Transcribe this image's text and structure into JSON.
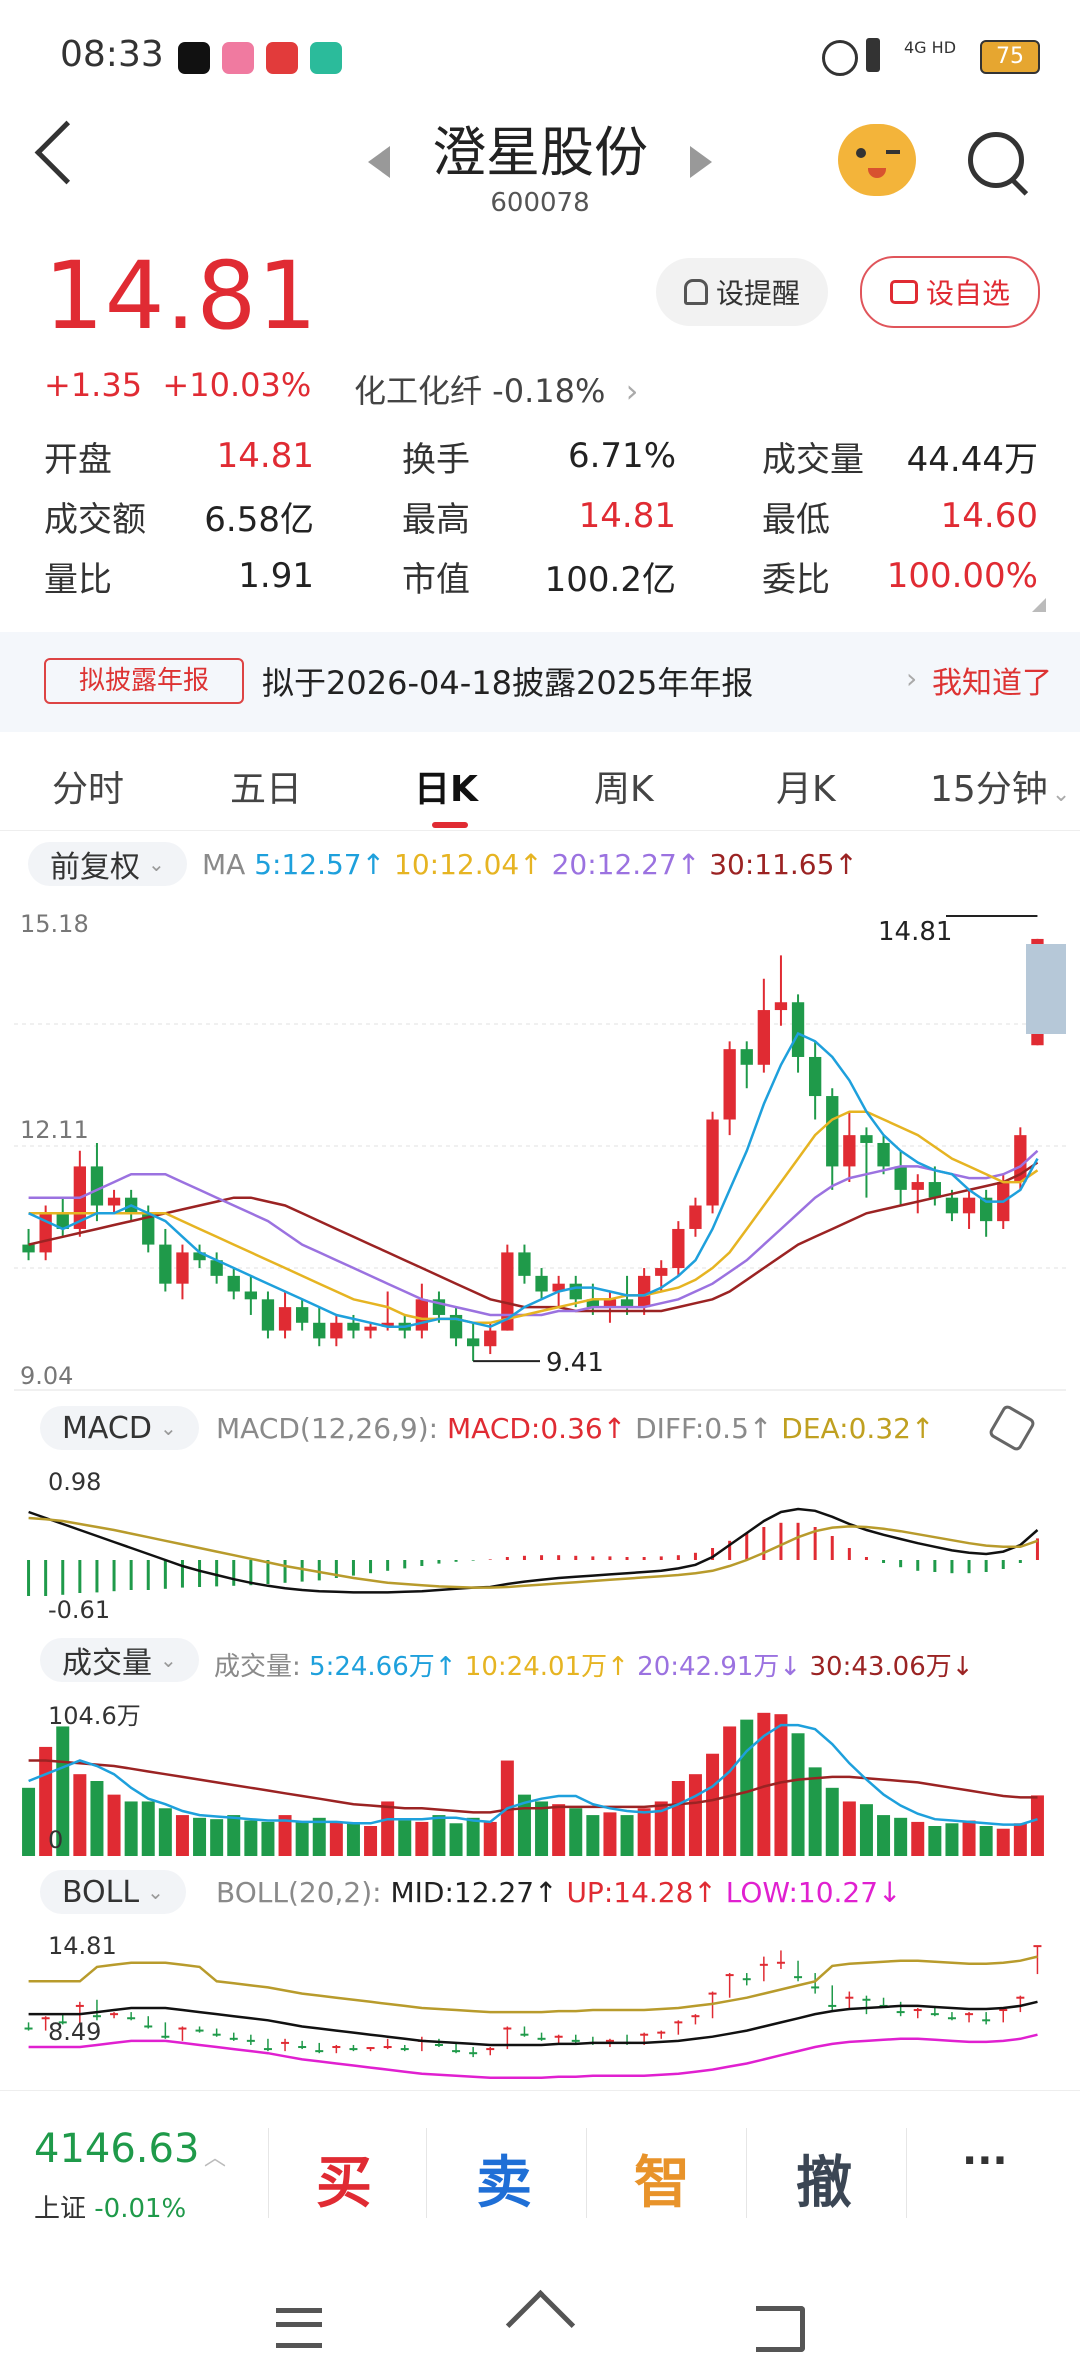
{
  "status": {
    "time": "08:33",
    "network": "4G HD",
    "battery": "75"
  },
  "header": {
    "title": "澄星股份",
    "code": "600078"
  },
  "price": {
    "last": "14.81",
    "change": "+1.35",
    "pct": "+10.03%",
    "sector": "化工化纤 -0.18%"
  },
  "buttons": {
    "alert": "设提醒",
    "favorite": "设自选"
  },
  "quote": {
    "c1": [
      {
        "label": "开盘",
        "value": "14.81"
      },
      {
        "label": "成交额",
        "value": "6.58亿"
      },
      {
        "label": "量比",
        "value": "1.91"
      }
    ],
    "c2": [
      {
        "label": "换手",
        "value": "6.71%"
      },
      {
        "label": "最高",
        "value": "14.81"
      },
      {
        "label": "市值",
        "value": "100.2亿"
      }
    ],
    "c3": [
      {
        "label": "成交量",
        "value": "44.44万"
      },
      {
        "label": "最低",
        "value": "14.60"
      },
      {
        "label": "委比",
        "value": "100.00%"
      }
    ]
  },
  "notice": {
    "tag": "拟披露年报",
    "text": "拟于2026-04-18披露2025年年报",
    "action": "我知道了"
  },
  "tabs": [
    "分时",
    "五日",
    "日K",
    "周K",
    "月K",
    "15分钟"
  ],
  "adjust": "前复权",
  "ma": {
    "label": "MA",
    "ma5": "5:12.57↑",
    "ma10": "10:12.04↑",
    "ma20": "20:12.27↑",
    "ma30": "30:11.65↑"
  },
  "kline": {
    "ymax": "15.18",
    "ymid": "12.11",
    "ymin": "9.04",
    "high_mark": "14.81",
    "low_mark": "9.41"
  },
  "macd": {
    "chip": "MACD",
    "params": "MACD(12,26,9):",
    "macd": "MACD:0.36↑",
    "diff": "DIFF:0.5↑",
    "dea": "DEA:0.32↑",
    "top": "0.98",
    "bottom": "-0.61"
  },
  "volume": {
    "chip": "成交量",
    "label": "成交量:",
    "v5": "5:24.66万↑",
    "v10": "10:24.01万↑",
    "v20": "20:42.91万↓",
    "v30": "30:43.06万↓",
    "top": "104.6万",
    "zero": "0"
  },
  "boll": {
    "chip": "BOLL",
    "params": "BOLL(20,2):",
    "mid": "MID:12.27↑",
    "up": "UP:14.28↑",
    "low": "LOW:10.27↓",
    "top": "14.81",
    "bottom": "8.49"
  },
  "index": {
    "value": "4146.63",
    "name": "上证",
    "pct": "-0.01%"
  },
  "actions": {
    "buy": "买",
    "sell": "卖",
    "smart": "智",
    "cancel": "撤",
    "more": "···"
  },
  "colors": {
    "up": "#e02b33",
    "down": "#1f9a4a",
    "ma5": "#1ea0dc",
    "ma10": "#e6b422",
    "ma20": "#9b72e0",
    "ma30": "#9b2323"
  },
  "chart_data": {
    "type": "candlestick",
    "ylim": [
      9.04,
      15.18
    ],
    "candles": [
      [
        10.9,
        11.1,
        10.7,
        10.8
      ],
      [
        10.8,
        11.4,
        10.7,
        11.3
      ],
      [
        11.3,
        11.5,
        11.0,
        11.1
      ],
      [
        11.1,
        12.1,
        11.0,
        11.9
      ],
      [
        11.9,
        12.2,
        11.2,
        11.4
      ],
      [
        11.4,
        11.6,
        11.3,
        11.5
      ],
      [
        11.5,
        11.6,
        11.2,
        11.3
      ],
      [
        11.3,
        11.4,
        10.8,
        10.9
      ],
      [
        10.9,
        11.1,
        10.3,
        10.4
      ],
      [
        10.4,
        10.9,
        10.2,
        10.8
      ],
      [
        10.8,
        10.9,
        10.6,
        10.7
      ],
      [
        10.7,
        10.8,
        10.4,
        10.5
      ],
      [
        10.5,
        10.6,
        10.2,
        10.3
      ],
      [
        10.3,
        10.5,
        10.0,
        10.2
      ],
      [
        10.2,
        10.3,
        9.7,
        9.8
      ],
      [
        9.8,
        10.3,
        9.7,
        10.1
      ],
      [
        10.1,
        10.2,
        9.8,
        9.9
      ],
      [
        9.9,
        10.1,
        9.6,
        9.7
      ],
      [
        9.7,
        10.0,
        9.6,
        9.9
      ],
      [
        9.9,
        10.0,
        9.7,
        9.8
      ],
      [
        9.8,
        9.9,
        9.7,
        9.85
      ],
      [
        9.85,
        10.3,
        9.8,
        9.9
      ],
      [
        9.9,
        10.0,
        9.7,
        9.8
      ],
      [
        9.8,
        10.4,
        9.7,
        10.2
      ],
      [
        10.2,
        10.3,
        9.9,
        10.0
      ],
      [
        10.0,
        10.1,
        9.6,
        9.7
      ],
      [
        9.7,
        9.9,
        9.41,
        9.6
      ],
      [
        9.6,
        9.9,
        9.5,
        9.8
      ],
      [
        9.8,
        10.9,
        9.8,
        10.8
      ],
      [
        10.8,
        10.9,
        10.4,
        10.5
      ],
      [
        10.5,
        10.6,
        10.2,
        10.3
      ],
      [
        10.3,
        10.5,
        10.1,
        10.4
      ],
      [
        10.4,
        10.5,
        10.1,
        10.2
      ],
      [
        10.2,
        10.4,
        10.0,
        10.1
      ],
      [
        10.1,
        10.3,
        9.9,
        10.2
      ],
      [
        10.2,
        10.5,
        10.0,
        10.1
      ],
      [
        10.1,
        10.6,
        10.0,
        10.5
      ],
      [
        10.5,
        10.7,
        10.3,
        10.6
      ],
      [
        10.6,
        11.2,
        10.5,
        11.1
      ],
      [
        11.1,
        11.5,
        11.0,
        11.4
      ],
      [
        11.4,
        12.6,
        11.3,
        12.5
      ],
      [
        12.5,
        13.5,
        12.3,
        13.4
      ],
      [
        13.4,
        13.5,
        12.9,
        13.2
      ],
      [
        13.2,
        14.3,
        13.1,
        13.9
      ],
      [
        13.9,
        14.6,
        13.7,
        14.0
      ],
      [
        14.0,
        14.1,
        13.1,
        13.3
      ],
      [
        13.3,
        13.5,
        12.5,
        12.8
      ],
      [
        12.8,
        12.9,
        11.6,
        11.9
      ],
      [
        11.9,
        12.6,
        11.7,
        12.3
      ],
      [
        12.3,
        12.4,
        11.5,
        12.2
      ],
      [
        12.2,
        12.3,
        11.8,
        11.9
      ],
      [
        11.9,
        12.1,
        11.4,
        11.6
      ],
      [
        11.6,
        11.8,
        11.3,
        11.7
      ],
      [
        11.7,
        11.9,
        11.4,
        11.5
      ],
      [
        11.5,
        11.6,
        11.2,
        11.3
      ],
      [
        11.3,
        11.6,
        11.1,
        11.5
      ],
      [
        11.5,
        11.6,
        11.0,
        11.2
      ],
      [
        11.2,
        11.8,
        11.1,
        11.7
      ],
      [
        11.7,
        12.4,
        11.6,
        12.3
      ],
      [
        13.45,
        14.81,
        13.45,
        14.81
      ]
    ],
    "ma5": [
      11.3,
      11.2,
      11.1,
      11.2,
      11.3,
      11.3,
      11.4,
      11.3,
      11.2,
      11.0,
      10.8,
      10.7,
      10.6,
      10.5,
      10.4,
      10.3,
      10.2,
      10.1,
      10.0,
      9.95,
      9.9,
      9.85,
      9.85,
      9.9,
      9.95,
      9.95,
      9.9,
      9.85,
      9.95,
      10.1,
      10.2,
      10.3,
      10.35,
      10.35,
      10.3,
      10.25,
      10.25,
      10.35,
      10.5,
      10.7,
      11.1,
      11.6,
      12.1,
      12.7,
      13.2,
      13.6,
      13.5,
      13.3,
      13.0,
      12.6,
      12.3,
      12.1,
      11.95,
      11.85,
      11.8,
      11.6,
      11.45,
      11.45,
      11.6,
      12.0
    ],
    "ma10": [
      11.3,
      11.3,
      11.3,
      11.3,
      11.3,
      11.3,
      11.3,
      11.3,
      11.3,
      11.2,
      11.1,
      11.0,
      10.9,
      10.8,
      10.7,
      10.6,
      10.5,
      10.4,
      10.3,
      10.2,
      10.15,
      10.1,
      10.0,
      9.95,
      9.95,
      9.95,
      9.9,
      9.9,
      9.95,
      10.0,
      10.05,
      10.1,
      10.15,
      10.2,
      10.2,
      10.25,
      10.25,
      10.3,
      10.35,
      10.45,
      10.6,
      10.8,
      11.1,
      11.4,
      11.7,
      12.0,
      12.3,
      12.5,
      12.6,
      12.6,
      12.5,
      12.4,
      12.3,
      12.15,
      12.0,
      11.9,
      11.8,
      11.7,
      11.7,
      11.85
    ],
    "ma20": [
      11.5,
      11.5,
      11.5,
      11.5,
      11.6,
      11.7,
      11.8,
      11.8,
      11.8,
      11.7,
      11.6,
      11.5,
      11.4,
      11.3,
      11.2,
      11.05,
      10.9,
      10.8,
      10.7,
      10.6,
      10.5,
      10.4,
      10.3,
      10.2,
      10.15,
      10.1,
      10.05,
      10.0,
      10.0,
      10.0,
      10.0,
      10.05,
      10.05,
      10.1,
      10.1,
      10.1,
      10.1,
      10.15,
      10.2,
      10.3,
      10.4,
      10.55,
      10.7,
      10.9,
      11.1,
      11.3,
      11.5,
      11.65,
      11.75,
      11.8,
      11.85,
      11.9,
      11.9,
      11.85,
      11.8,
      11.75,
      11.75,
      11.8,
      11.9,
      12.1
    ],
    "ma30": [
      10.9,
      10.95,
      11.0,
      11.05,
      11.1,
      11.15,
      11.2,
      11.25,
      11.3,
      11.35,
      11.4,
      11.45,
      11.5,
      11.5,
      11.45,
      11.4,
      11.3,
      11.2,
      11.1,
      11.0,
      10.9,
      10.8,
      10.7,
      10.6,
      10.5,
      10.4,
      10.3,
      10.2,
      10.15,
      10.1,
      10.1,
      10.1,
      10.05,
      10.05,
      10.05,
      10.05,
      10.05,
      10.05,
      10.1,
      10.15,
      10.2,
      10.3,
      10.45,
      10.6,
      10.75,
      10.9,
      11.0,
      11.1,
      11.2,
      11.3,
      11.35,
      11.4,
      11.45,
      11.5,
      11.55,
      11.6,
      11.65,
      11.7,
      11.8,
      11.95
    ],
    "macd_hist": [
      -0.6,
      -0.6,
      -0.58,
      -0.55,
      -0.54,
      -0.52,
      -0.5,
      -0.5,
      -0.48,
      -0.46,
      -0.45,
      -0.44,
      -0.43,
      -0.42,
      -0.4,
      -0.38,
      -0.36,
      -0.34,
      -0.3,
      -0.26,
      -0.22,
      -0.18,
      -0.14,
      -0.1,
      -0.06,
      -0.03,
      -0.01,
      0.01,
      0.05,
      0.07,
      0.08,
      0.08,
      0.07,
      0.06,
      0.06,
      0.05,
      0.05,
      0.06,
      0.08,
      0.12,
      0.2,
      0.32,
      0.45,
      0.55,
      0.62,
      0.62,
      0.55,
      0.4,
      0.2,
      0.05,
      -0.05,
      -0.12,
      -0.18,
      -0.2,
      -0.22,
      -0.22,
      -0.2,
      -0.15,
      -0.05,
      0.36
    ],
    "diff": [
      0.8,
      0.7,
      0.6,
      0.5,
      0.4,
      0.3,
      0.2,
      0.1,
      0.0,
      -0.1,
      -0.18,
      -0.25,
      -0.32,
      -0.38,
      -0.43,
      -0.47,
      -0.5,
      -0.52,
      -0.53,
      -0.54,
      -0.54,
      -0.54,
      -0.53,
      -0.52,
      -0.5,
      -0.48,
      -0.46,
      -0.45,
      -0.4,
      -0.36,
      -0.33,
      -0.3,
      -0.28,
      -0.26,
      -0.24,
      -0.22,
      -0.2,
      -0.18,
      -0.14,
      -0.08,
      0.05,
      0.25,
      0.45,
      0.65,
      0.8,
      0.85,
      0.82,
      0.72,
      0.6,
      0.5,
      0.42,
      0.35,
      0.28,
      0.22,
      0.16,
      0.12,
      0.1,
      0.14,
      0.25,
      0.5
    ],
    "dea": [
      0.7,
      0.68,
      0.65,
      0.6,
      0.55,
      0.5,
      0.44,
      0.38,
      0.32,
      0.26,
      0.2,
      0.14,
      0.08,
      0.02,
      -0.04,
      -0.1,
      -0.15,
      -0.2,
      -0.25,
      -0.3,
      -0.34,
      -0.38,
      -0.4,
      -0.42,
      -0.44,
      -0.45,
      -0.46,
      -0.46,
      -0.45,
      -0.43,
      -0.41,
      -0.39,
      -0.37,
      -0.35,
      -0.33,
      -0.31,
      -0.29,
      -0.27,
      -0.25,
      -0.22,
      -0.18,
      -0.1,
      0.0,
      0.12,
      0.25,
      0.38,
      0.48,
      0.54,
      0.56,
      0.55,
      0.52,
      0.48,
      0.43,
      0.38,
      0.33,
      0.28,
      0.24,
      0.22,
      0.22,
      0.32
    ],
    "vol": [
      50,
      80,
      95,
      60,
      55,
      45,
      40,
      40,
      35,
      30,
      28,
      27,
      30,
      26,
      25,
      30,
      25,
      28,
      25,
      24,
      22,
      40,
      26,
      25,
      30,
      24,
      28,
      25,
      70,
      45,
      40,
      38,
      35,
      30,
      32,
      30,
      35,
      40,
      55,
      60,
      75,
      95,
      100,
      105,
      104,
      90,
      65,
      50,
      40,
      38,
      30,
      28,
      25,
      22,
      24,
      26,
      22,
      20,
      24,
      44.44
    ],
    "vol_ma5": [
      55,
      60,
      65,
      70,
      66,
      60,
      50,
      42,
      38,
      33,
      30,
      29,
      28,
      27,
      26,
      26,
      25,
      25,
      25,
      24,
      24,
      27,
      27,
      27,
      28,
      28,
      26,
      25,
      35,
      39,
      42,
      44,
      44,
      38,
      35,
      33,
      32,
      33,
      38,
      44,
      51,
      62,
      77,
      88,
      96,
      96,
      93,
      82,
      68,
      56,
      45,
      37,
      31,
      27,
      26,
      25,
      24,
      23,
      23,
      27
    ],
    "vol_ma20": [
      70,
      70,
      69,
      68,
      67,
      66,
      64,
      62,
      60,
      58,
      56,
      54,
      52,
      50,
      48,
      46,
      44,
      42,
      40,
      38,
      37,
      36,
      35,
      35,
      34,
      33,
      32,
      32,
      34,
      35,
      35,
      36,
      36,
      36,
      36,
      36,
      36,
      37,
      38,
      39,
      41,
      44,
      47,
      51,
      54,
      56,
      57,
      58,
      58,
      57,
      56,
      55,
      54,
      52,
      50,
      48,
      46,
      44,
      43,
      43
    ]
  }
}
